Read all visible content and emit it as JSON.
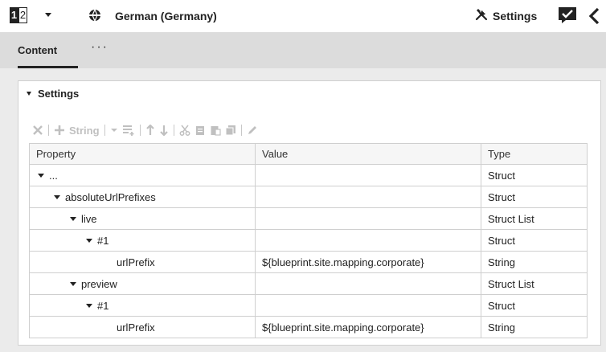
{
  "pager": {
    "current": "1",
    "next": "2"
  },
  "locale": {
    "label": "German (Germany)",
    "icon": "locale-split-circle-icon"
  },
  "settings_button": {
    "label": "Settings",
    "icon": "tools-icon"
  },
  "tabs": [
    {
      "label": "Content",
      "active": true
    },
    {
      "label": "···"
    }
  ],
  "panel": {
    "title": "Settings",
    "toolbar": {
      "string_label": "String"
    },
    "table": {
      "columns": [
        "Property",
        "Value",
        "Type"
      ],
      "rows": [
        {
          "property": "...",
          "value": "",
          "type": "Struct",
          "depth": 0,
          "expandable": true
        },
        {
          "property": "absoluteUrlPrefixes",
          "value": "",
          "type": "Struct",
          "depth": 1,
          "expandable": true
        },
        {
          "property": "live",
          "value": "",
          "type": "Struct List",
          "depth": 2,
          "expandable": true
        },
        {
          "property": "#1",
          "value": "",
          "type": "Struct",
          "depth": 3,
          "expandable": true
        },
        {
          "property": "urlPrefix",
          "value": "${blueprint.site.mapping.corporate}",
          "type": "String",
          "depth": 4,
          "expandable": false
        },
        {
          "property": "preview",
          "value": "",
          "type": "Struct List",
          "depth": 2,
          "expandable": true
        },
        {
          "property": "#1",
          "value": "",
          "type": "Struct",
          "depth": 3,
          "expandable": true
        },
        {
          "property": "urlPrefix",
          "value": "${blueprint.site.mapping.corporate}",
          "type": "String",
          "depth": 4,
          "expandable": false
        }
      ]
    }
  },
  "colors": {
    "tab_strip": "#dcdcdc",
    "content_bg": "#ebebeb",
    "disabled_icon": "#c0c0c0",
    "text": "#222222"
  }
}
